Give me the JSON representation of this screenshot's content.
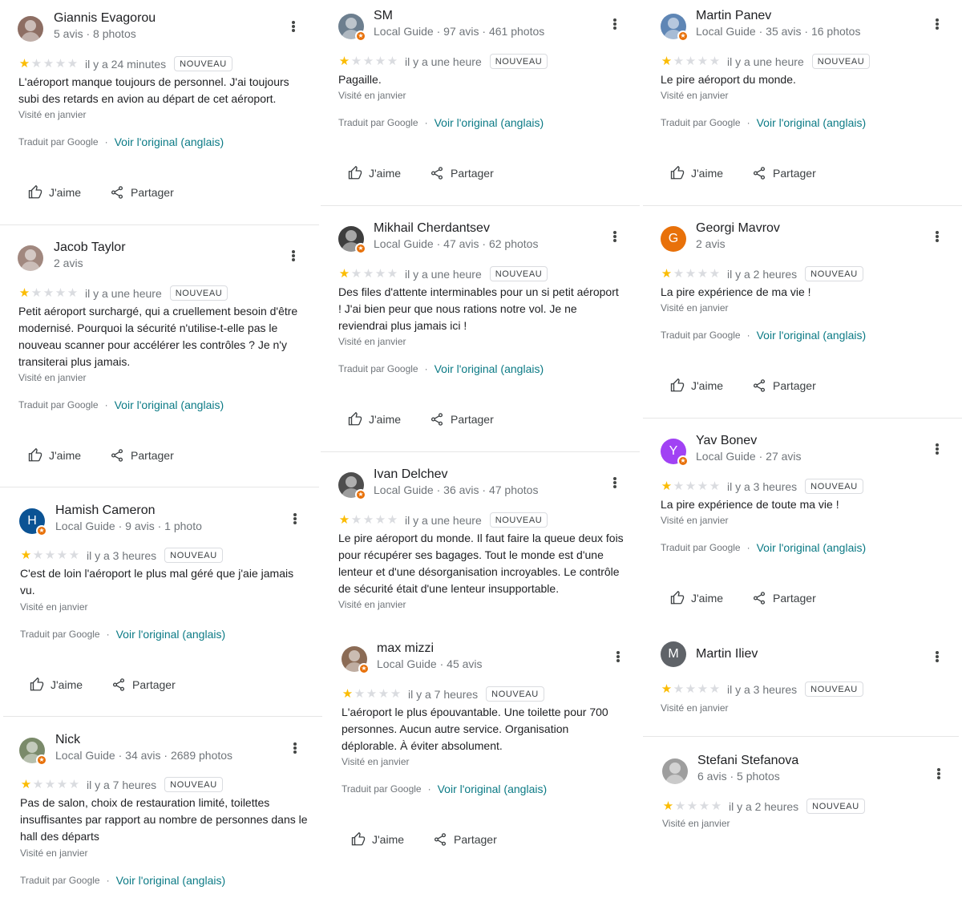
{
  "common": {
    "translated_by": "Traduit par Google",
    "dot": "·",
    "original_link": "Voir l'original (anglais)",
    "like_label": "J'aime",
    "share_label": "Partager",
    "badge_new": "NOUVEAU",
    "visited": "Visité en janvier"
  },
  "colors": {
    "star_filled": "#fbbc04",
    "star_empty": "#dadce0",
    "link": "#0b7a85",
    "local_guide_badge": "#e8710a"
  },
  "columns": [
    {
      "reviews": [
        {
          "name": "Giannis Evagorou",
          "meta": "5 avis · 8 photos",
          "avatar": {
            "kind": "photo",
            "color": "#8d6e63",
            "letter": ""
          },
          "local_guide": false,
          "rating": 1,
          "time": "il y a 24 minutes",
          "text": "L'aéroport manque toujours de personnel. J'ai toujours subi des retards en avion au départ de cet aéroport.",
          "visited": true,
          "translated": true
        },
        {
          "name": "Jacob Taylor",
          "meta": "2 avis",
          "avatar": {
            "kind": "photo",
            "color": "#a1887f",
            "letter": ""
          },
          "local_guide": false,
          "rating": 1,
          "time": "il y a une heure",
          "text": "Petit aéroport surchargé, qui a cruellement besoin d'être modernisé. Pourquoi la sécurité n'utilise-t-elle pas le nouveau scanner pour accélérer les contrôles ? Je n'y transiterai plus jamais.",
          "visited": true,
          "translated": true
        },
        {
          "name": "Hamish Cameron",
          "meta": "Local Guide · 9 avis · 1 photo",
          "avatar": {
            "kind": "letter",
            "color": "#0b5394",
            "letter": "H"
          },
          "local_guide": true,
          "rating": 1,
          "time": "il y a 3 heures",
          "text": "C'est de loin l'aéroport le plus mal géré que j'aie jamais vu.",
          "visited": true,
          "translated": true
        },
        {
          "name": "Nick",
          "meta": "Local Guide · 34 avis · 2689 photos",
          "avatar": {
            "kind": "photo",
            "color": "#7a8a6a",
            "letter": ""
          },
          "local_guide": true,
          "rating": 1,
          "time": "il y a 7 heures",
          "text": "Pas de salon, choix de restauration limité, toilettes insuffisantes par rapport au nombre de personnes dans le hall des départs",
          "visited": true,
          "translated": true
        }
      ]
    },
    {
      "reviews": [
        {
          "name": "SM",
          "meta": "Local Guide · 97 avis · 461 photos",
          "avatar": {
            "kind": "photo",
            "color": "#6d7f8f",
            "letter": ""
          },
          "local_guide": true,
          "rating": 1,
          "time": "il y a une heure",
          "text": "Pagaille.",
          "visited": true,
          "translated": true
        },
        {
          "name": "Mikhail Cherdantsev",
          "meta": "Local Guide · 47 avis · 62 photos",
          "avatar": {
            "kind": "photo",
            "color": "#3e3e3e",
            "letter": ""
          },
          "local_guide": true,
          "rating": 1,
          "time": "il y a une heure",
          "text": "Des files d'attente interminables pour un si petit aéroport ! J'ai bien peur que nous rations notre vol. Je ne reviendrai plus jamais ici !",
          "visited": true,
          "translated": true
        },
        {
          "name": "Ivan Delchev",
          "meta": "Local Guide · 36 avis · 47 photos",
          "avatar": {
            "kind": "photo",
            "color": "#4e4e4e",
            "letter": ""
          },
          "local_guide": true,
          "rating": 1,
          "time": "il y a une heure",
          "text": "Le pire aéroport du monde. Il faut faire la queue deux fois pour récupérer ses bagages. Tout le monde est d'une lenteur et d'une désorganisation incroyables. Le contrôle de sécurité était d'une lenteur insupportable.",
          "visited": true,
          "translated": false
        },
        {
          "name": "max mizzi",
          "meta": "Local Guide · 45 avis",
          "avatar": {
            "kind": "photo",
            "color": "#8b6b55",
            "letter": ""
          },
          "local_guide": true,
          "rating": 1,
          "time": "il y a 7 heures",
          "text": "L'aéroport le plus épouvantable. Une toilette pour 700 personnes. Aucun autre service. Organisation déplorable. À éviter absolument.",
          "visited": true,
          "translated": true
        }
      ]
    },
    {
      "reviews": [
        {
          "name": "Martin Panev",
          "meta": "Local Guide · 35 avis · 16 photos",
          "avatar": {
            "kind": "photo",
            "color": "#5f86b5",
            "letter": ""
          },
          "local_guide": true,
          "rating": 1,
          "time": "il y a une heure",
          "text": "Le pire aéroport du monde.",
          "visited": true,
          "translated": true
        },
        {
          "name": "Georgi Mavrov",
          "meta": "2 avis",
          "avatar": {
            "kind": "letter",
            "color": "#e8710a",
            "letter": "G"
          },
          "local_guide": false,
          "rating": 1,
          "time": "il y a 2 heures",
          "text": "La pire expérience de ma vie !",
          "visited": true,
          "translated": true
        },
        {
          "name": "Yav Bonev",
          "meta": "Local Guide · 27 avis",
          "avatar": {
            "kind": "letter",
            "color": "#a142f4",
            "letter": "Y"
          },
          "local_guide": true,
          "rating": 1,
          "time": "il y a 3 heures",
          "text": "La pire expérience de toute ma vie !",
          "visited": true,
          "translated": true
        },
        {
          "name": "Martin Iliev",
          "meta": "",
          "avatar": {
            "kind": "letter",
            "color": "#5f6368",
            "letter": "M"
          },
          "local_guide": false,
          "rating": 1,
          "time": "il y a 3 heures",
          "text": "",
          "visited": true,
          "translated": false
        },
        {
          "name": "Stefani Stefanova",
          "meta": "6 avis · 5 photos",
          "avatar": {
            "kind": "photo",
            "color": "#9e9e9e",
            "letter": ""
          },
          "local_guide": false,
          "rating": 1,
          "time": "il y a 2 heures",
          "text": "",
          "visited": true,
          "translated": false
        }
      ]
    }
  ]
}
